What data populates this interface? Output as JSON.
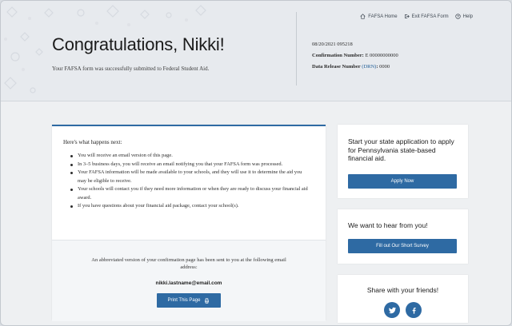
{
  "header": {
    "links": [
      {
        "label": "FAFSA Home",
        "icon": "home-icon"
      },
      {
        "label": "Exit FAFSA Form",
        "icon": "exit-icon"
      },
      {
        "label": "Help",
        "icon": "help-icon"
      }
    ],
    "title": "Congratulations, Nikki!",
    "subtitle": "Your FAFSA form was successfully submitted to Federal Student Aid.",
    "meta": {
      "datetime": "08/20/2021 095218",
      "confirmation_label": "Confirmation Number:",
      "confirmation_value": "E 00000000000",
      "drn_label": "Data Release Number",
      "drn_link": "(DRN)",
      "drn_value": "0000"
    }
  },
  "main": {
    "next_title": "Here's what happens next:",
    "next_items": [
      "You will receive an email version of this page.",
      "In 3–5 business days, you will receive an email notifying you that your FAFSA form was processed.",
      "Your FAFSA information will be made available to your schools, and they will use it to determine the aid you may be eligible to receive.",
      "Your schools will contact you if they need more information or when they are ready to discuss your financial aid award.",
      "If you have questions about your financial aid package, contact your school(s)."
    ],
    "confirmation_text": "An abbreviated version of your confirmation page has been sent to you at the following email address:",
    "email": "nikki.lastname@email.com",
    "print_label": "Print This Page"
  },
  "sidebar": {
    "state_heading": "Start your state application to apply for Pennsylvania state-based financial aid.",
    "state_button": "Apply Now",
    "survey_heading": "We want to hear from you!",
    "survey_button": "Fill out Our Short Survey",
    "share_heading": "Share with your friends!",
    "social": [
      "twitter-icon",
      "facebook-icon"
    ]
  },
  "colors": {
    "primary": "#2e6aa3",
    "header_bg": "#e7eaee",
    "page_bg": "#eef0f2"
  }
}
